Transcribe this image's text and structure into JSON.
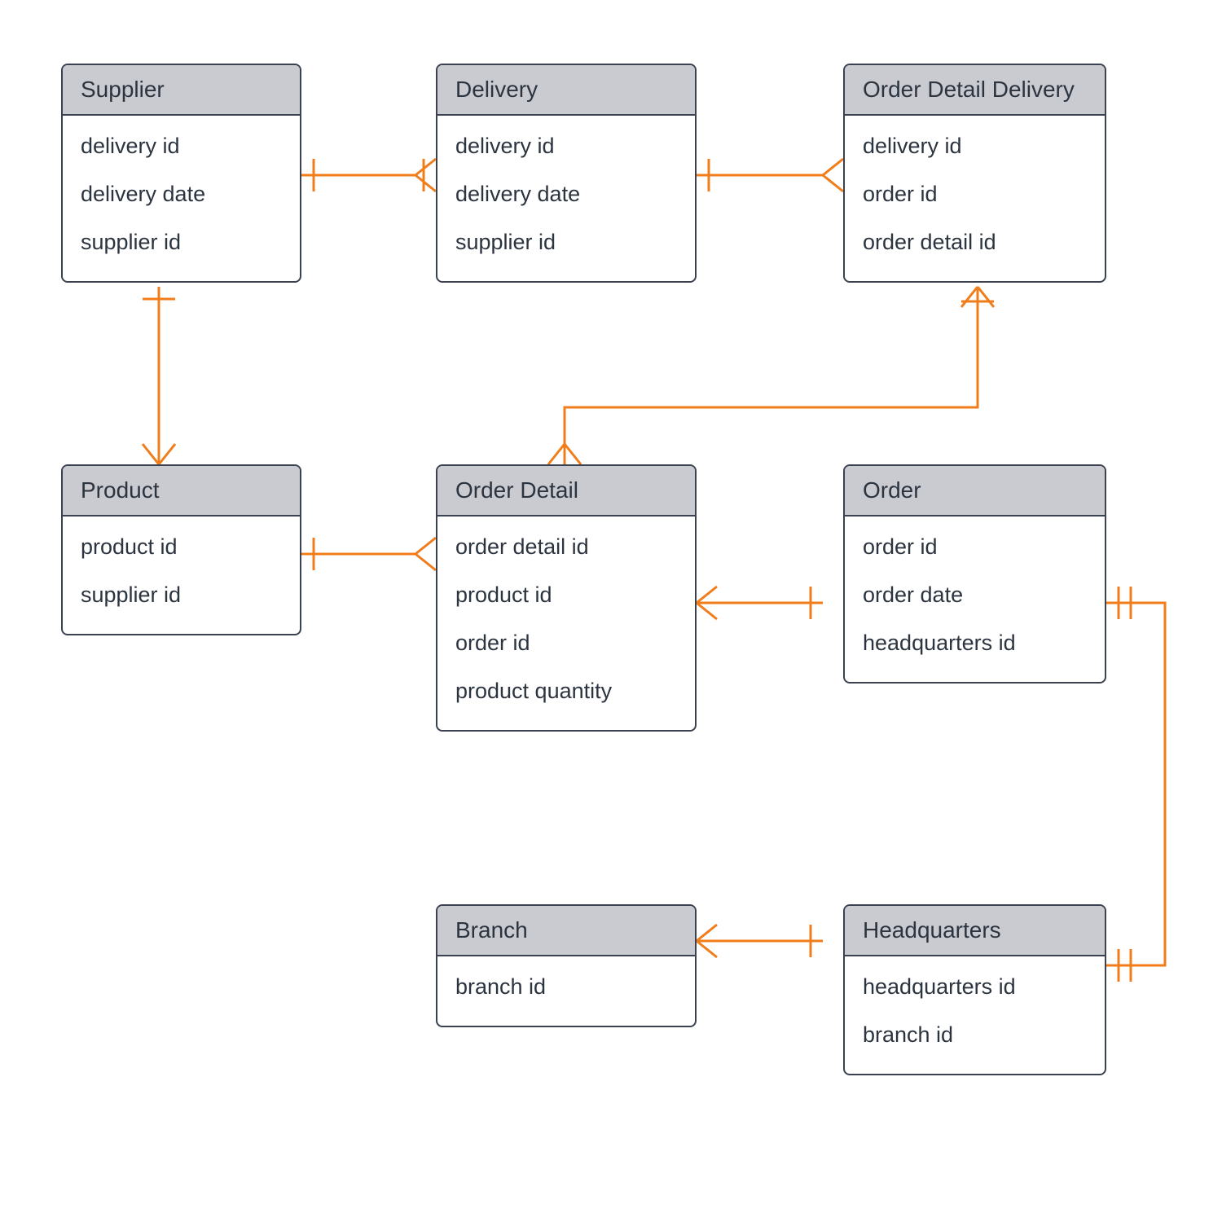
{
  "entities": {
    "supplier": {
      "title": "Supplier",
      "attrs": [
        "delivery id",
        "delivery date",
        "supplier id"
      ]
    },
    "delivery": {
      "title": "Delivery",
      "attrs": [
        "delivery id",
        "delivery date",
        "supplier id"
      ]
    },
    "order_detail_delivery": {
      "title": "Order Detail Delivery",
      "attrs": [
        "delivery id",
        "order id",
        "order detail id"
      ]
    },
    "product": {
      "title": "Product",
      "attrs": [
        "product id",
        "supplier id"
      ]
    },
    "order_detail": {
      "title": "Order Detail",
      "attrs": [
        "order detail id",
        "product id",
        "order id",
        "product quantity"
      ]
    },
    "order": {
      "title": "Order",
      "attrs": [
        "order id",
        "order date",
        "headquarters id"
      ]
    },
    "branch": {
      "title": "Branch",
      "attrs": [
        "branch id"
      ]
    },
    "headquarters": {
      "title": "Headquarters",
      "attrs": [
        "headquarters id",
        "branch id"
      ]
    }
  },
  "colors": {
    "connector": "#f07d1a",
    "border": "#3a4150",
    "header_bg": "#c9cbd0"
  }
}
